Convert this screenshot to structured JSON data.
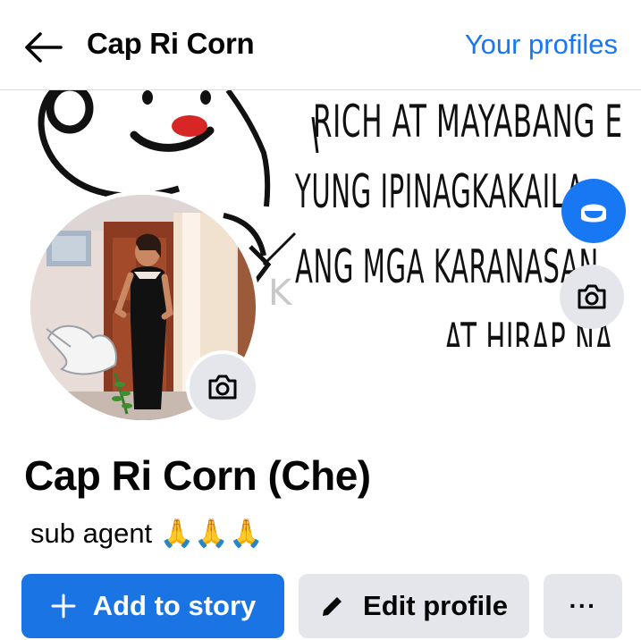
{
  "header": {
    "title": "Cap Ri Corn",
    "your_profiles": "Your profiles"
  },
  "cover": {
    "lines": [
      "RICH AT MAYABANG E",
      "YUNG IPINAGKAKAILA",
      "ANG MGA KARANASAN",
      "AT HIRAP NA"
    ]
  },
  "profile": {
    "name": "Cap Ri Corn (Che)",
    "bio": "sub agent 🙏🙏🙏"
  },
  "actions": {
    "add_to_story": "Add to story",
    "edit_profile": "Edit profile",
    "more": "···"
  },
  "colors": {
    "accent": "#1877f2",
    "button_primary": "#1b74e4",
    "button_secondary": "#e4e6eb"
  }
}
